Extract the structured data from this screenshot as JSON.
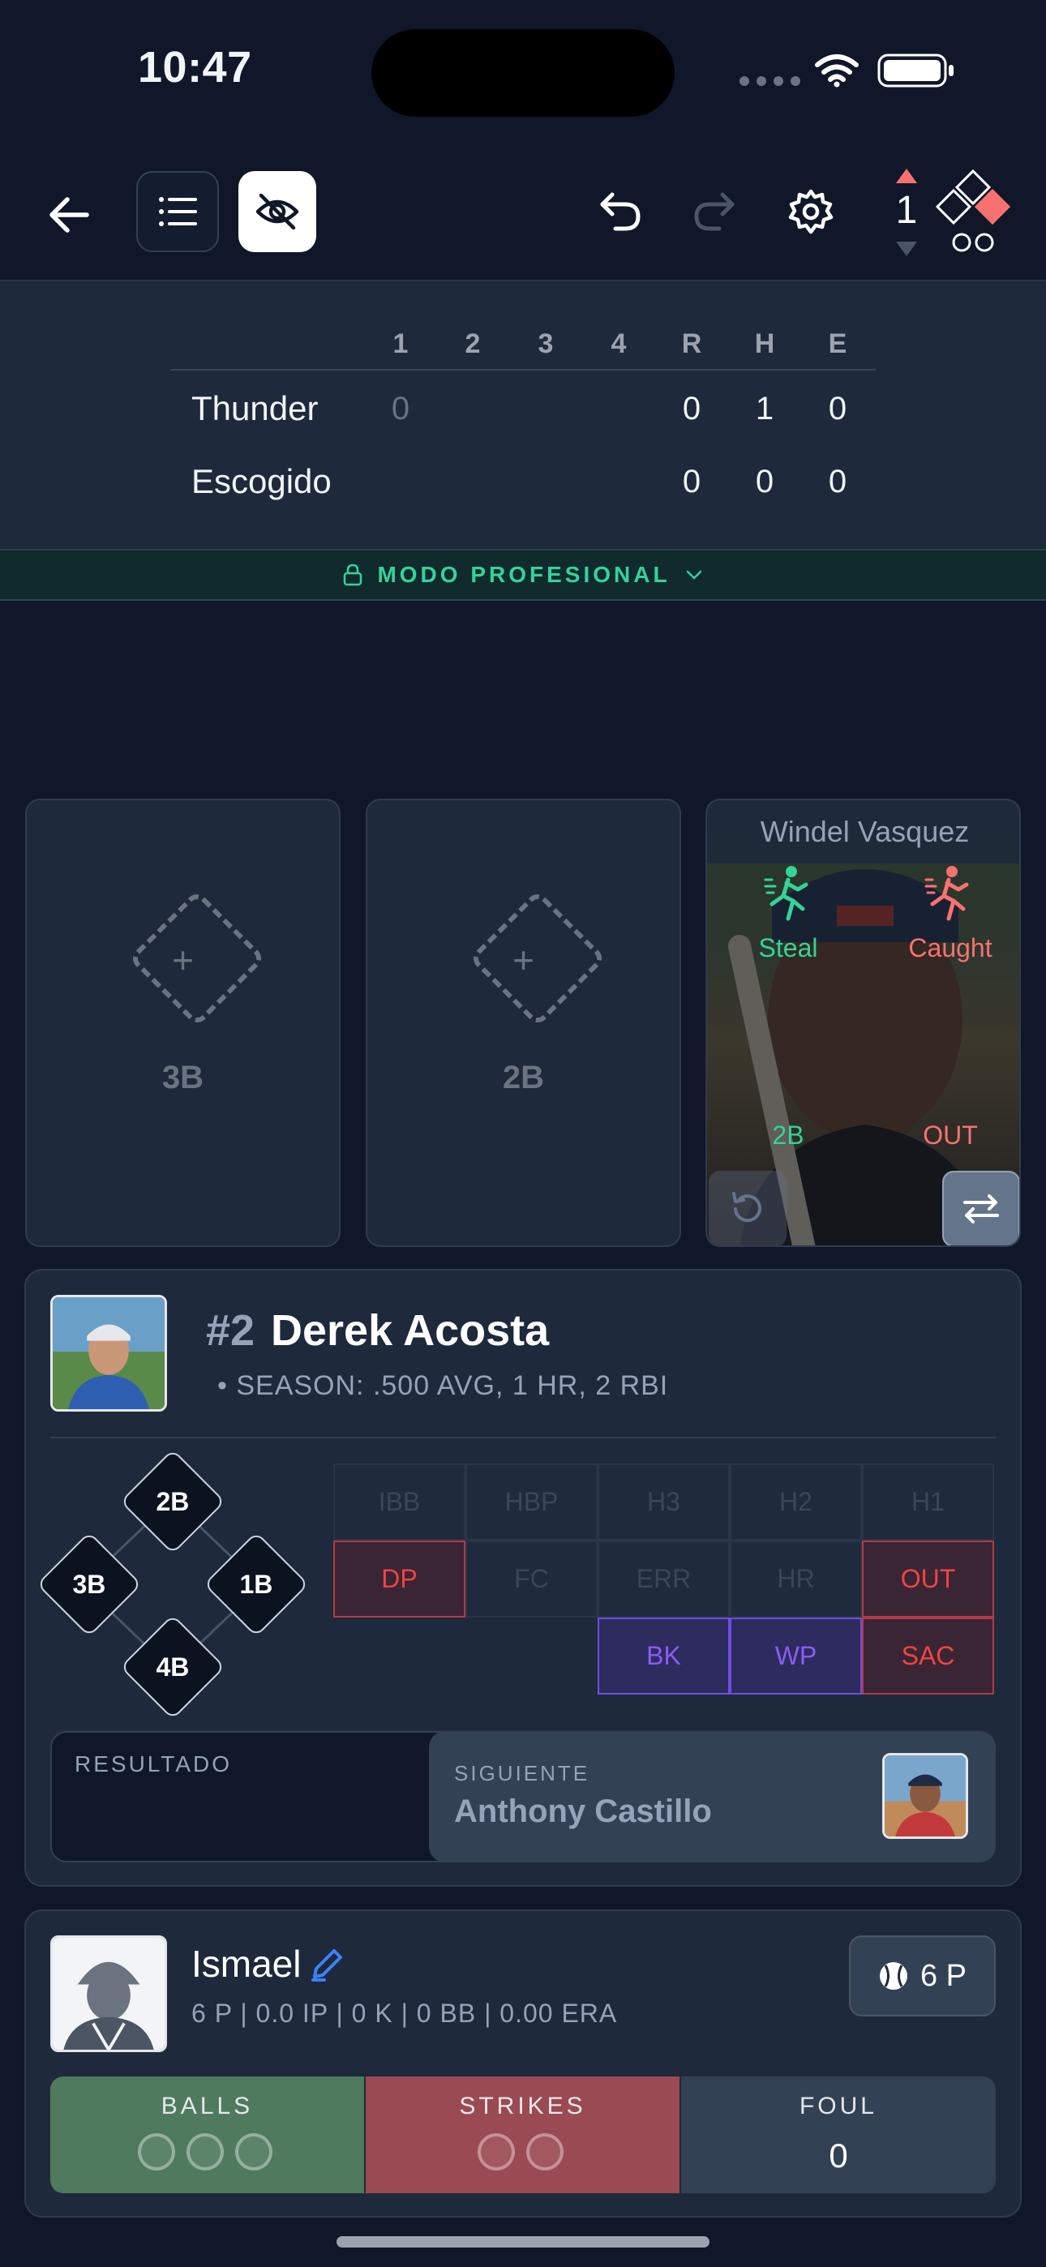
{
  "status_bar": {
    "time": "10:47"
  },
  "toolbar": {
    "inning_number": "1",
    "back_icon": "arrow-left-icon",
    "list_icon": "list-icon",
    "visibility_icon": "eye-off-icon",
    "undo_icon": "undo-icon",
    "redo_icon": "redo-icon",
    "settings_icon": "gear-icon"
  },
  "scoreboard": {
    "headers": [
      "1",
      "2",
      "3",
      "4",
      "R",
      "H",
      "E"
    ],
    "rows": [
      {
        "team": "Thunder",
        "innings": [
          "0",
          "",
          "",
          ""
        ],
        "r": "0",
        "h": "1",
        "e": "0"
      },
      {
        "team": "Escogido",
        "innings": [
          "",
          "",
          "",
          ""
        ],
        "r": "0",
        "h": "0",
        "e": "0"
      }
    ]
  },
  "mode_banner": {
    "label": "MODO PROFESIONAL"
  },
  "bases": {
    "third": {
      "label": "3B",
      "plus": "+"
    },
    "second": {
      "label": "2B",
      "plus": "+"
    },
    "runner": {
      "name": "Windel Vasquez",
      "steal_label": "Steal",
      "caught_label": "Caught",
      "advance_label": "2B",
      "out_label": "OUT"
    }
  },
  "batter": {
    "number": "#2",
    "name": "Derek Acosta",
    "season_stats": "• SEASON: .500 AVG, 1 HR, 2 RBI",
    "diamond": {
      "second": "2B",
      "third": "3B",
      "first": "1B",
      "home": "4B"
    },
    "outcomes_row1": [
      "IBB",
      "HBP",
      "H3",
      "H2",
      "H1"
    ],
    "outcomes_row2": [
      "DP",
      "FC",
      "ERR",
      "HR",
      "OUT"
    ],
    "outcomes_row3": [
      "BK",
      "WP",
      "SAC"
    ],
    "result_label": "RESULTADO",
    "next_label": "SIGUIENTE",
    "next_name": "Anthony Castillo"
  },
  "pitcher": {
    "name": "Ismael",
    "stats": "6 P | 0.0 IP | 0 K | 0 BB | 0.00 ERA",
    "pitch_count": "6 P",
    "balls_label": "BALLS",
    "strikes_label": "STRIKES",
    "foul_label": "FOUL",
    "foul_value": "0"
  },
  "colors": {
    "background": "#0f1729",
    "card": "#1e293b",
    "accent_green": "#34d399",
    "accent_red": "#f87171",
    "accent_purple": "#8b5cf6"
  }
}
